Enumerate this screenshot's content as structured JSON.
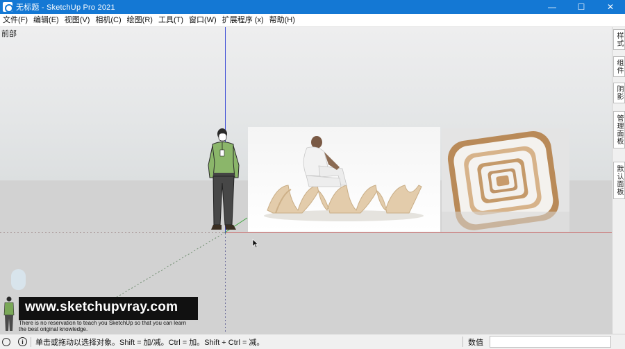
{
  "window": {
    "title": "无标题 - SketchUp Pro 2021",
    "minimize_glyph": "—",
    "maximize_glyph": "☐",
    "close_glyph": "✕"
  },
  "menu": [
    "文件(F)",
    "编辑(E)",
    "视图(V)",
    "相机(C)",
    "绘图(R)",
    "工具(T)",
    "窗口(W)",
    "扩展程序 (x)",
    "帮助(H)"
  ],
  "viewport": {
    "scene_label": "前部",
    "watermark": {
      "url": "www.sketchupvray.com",
      "line1": "There is no reservation to teach you SketchUp so that you can learn",
      "line2": "the best original knowledge."
    }
  },
  "tray_tabs": [
    "样式",
    "组件",
    "阴影",
    "管理面板",
    "默认面板"
  ],
  "status": {
    "hint": "单击或拖动以选择对象。Shift = 加/减。Ctrl = 加。Shift + Ctrl = 减。",
    "measurements_label": "数值",
    "measurements_value": ""
  },
  "colors": {
    "titlebar": "#1478d4",
    "axis_blue": "#3b4bd6",
    "axis_red": "#c96868",
    "axis_green": "#3aa63a"
  },
  "icons": {
    "app": "sketchup-logo-icon",
    "status_credit": "geo-location-icon",
    "status_info": "info-icon"
  }
}
